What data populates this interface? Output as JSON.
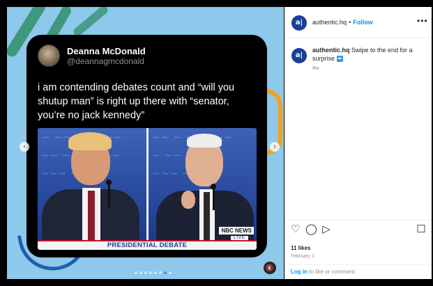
{
  "post": {
    "tweet": {
      "author_name": "Deanna McDonald",
      "author_handle": "@deannagmcdonald",
      "text": "i am contending debates count and “will you shutup man” is right up there with “senator, you’re no jack kennedy”"
    },
    "image_overlay": {
      "network_logo": "NBC NEWS",
      "network_live": "LIVE",
      "banner": "PRESIDENTIAL DEBATE"
    },
    "carousel": {
      "prev_icon": "‹",
      "next_icon": "›",
      "dot_count": 8,
      "active_dot": 6
    },
    "sound_icon": "🔇"
  },
  "sidebar": {
    "header": {
      "avatar_text": "a|",
      "username": "authentic.hq",
      "separator": "•",
      "follow_label": "Follow",
      "more_icon": "•••"
    },
    "caption": {
      "username": "authentic.hq",
      "text": " Swipe to the end for a surprise ",
      "emoji": "➡",
      "time": "8w"
    },
    "actions": {
      "like_icon": "♡",
      "comment_icon": "◯",
      "share_icon": "▷",
      "save_icon": "☐"
    },
    "likes": "11 likes",
    "date": "February 1",
    "comment_prompt": {
      "login_label": "Log in",
      "rest": " to like or comment."
    }
  },
  "colors": {
    "accent": "#0095f6",
    "brand": "#1a3f94",
    "media_bg": "#8ec8ea"
  }
}
